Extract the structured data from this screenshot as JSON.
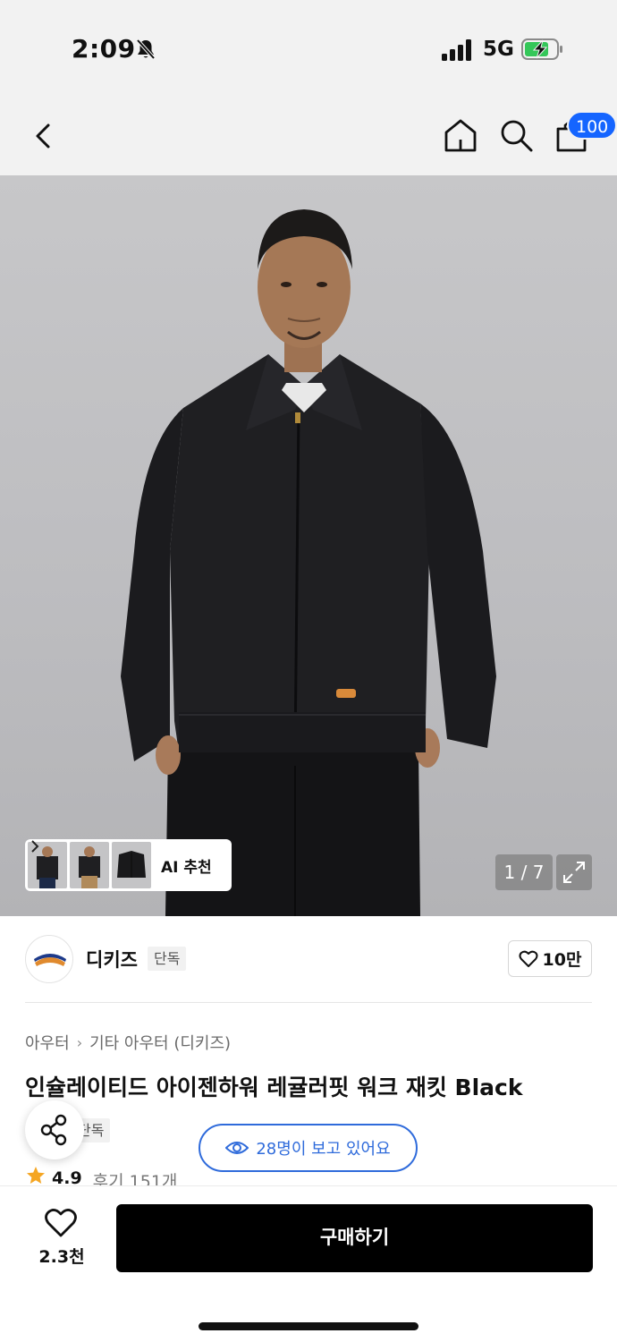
{
  "status_bar": {
    "time": "2:09",
    "network": "5G",
    "icons": [
      "bell-slash-icon",
      "signal-icon",
      "battery-charging-icon"
    ]
  },
  "nav": {
    "icons": [
      "back-chevron-icon",
      "home-icon",
      "search-icon",
      "shopping-bag-icon"
    ],
    "cart_badge": "100",
    "badge_color": "#1565ff"
  },
  "gallery": {
    "ai_label": "AI 추천",
    "page_counter": "1 / 7",
    "thumbnail_count": 3
  },
  "brand": {
    "name": "디키즈",
    "tag": "단독",
    "like_count": "10만"
  },
  "product": {
    "breadcrumb": [
      "아우터",
      "기타 아우터 (디키즈)"
    ],
    "title": "인슐레이티드 아이젠하워 레귤러핏 워크 재킷 Black",
    "tag": "단독",
    "viewers": "28명이 보고 있어요",
    "rating": "4.9",
    "reviews": "후기 151개",
    "accent_color": "#2f6bdb",
    "star_color": "#f5a623"
  },
  "bottom_bar": {
    "wish_count": "2.3천",
    "buy_label": "구매하기"
  }
}
